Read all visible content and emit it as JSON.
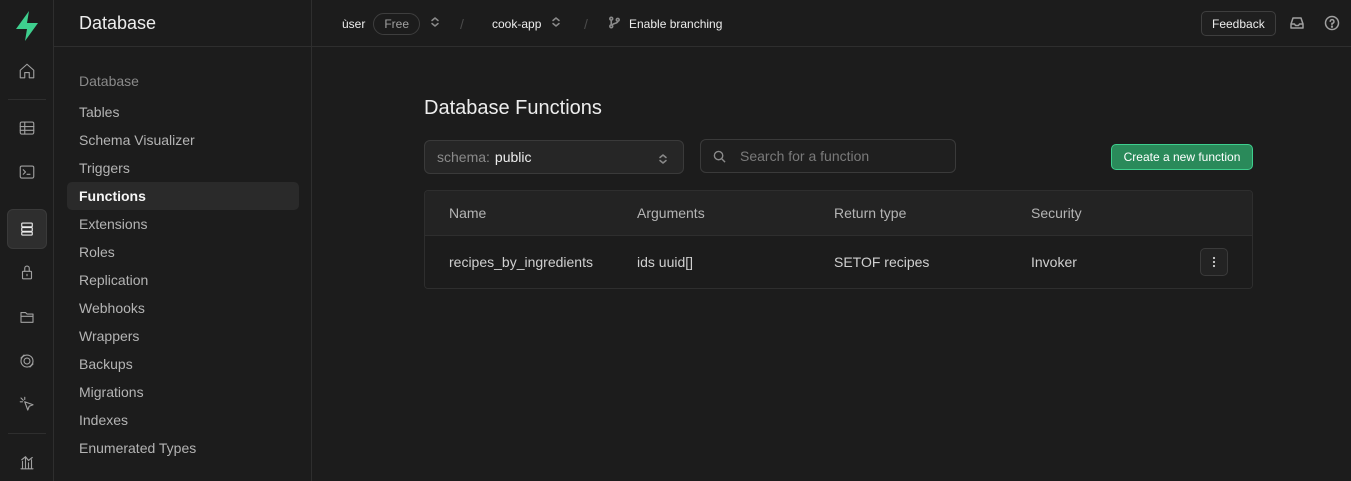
{
  "sidebar": {
    "title": "Database",
    "section_title": "Database",
    "items": [
      {
        "label": "Tables"
      },
      {
        "label": "Schema Visualizer"
      },
      {
        "label": "Triggers"
      },
      {
        "label": "Functions"
      },
      {
        "label": "Extensions"
      },
      {
        "label": "Roles"
      },
      {
        "label": "Replication"
      },
      {
        "label": "Webhooks"
      },
      {
        "label": "Wrappers"
      },
      {
        "label": "Backups"
      },
      {
        "label": "Migrations"
      },
      {
        "label": "Indexes"
      },
      {
        "label": "Enumerated Types"
      }
    ],
    "active_item": "Functions"
  },
  "rail": {
    "icons": [
      "supabase-logo",
      "home-icon",
      "table-editor-icon",
      "sql-editor-icon",
      "database-icon",
      "auth-lock-icon",
      "storage-icon",
      "realtime-icon",
      "edge-functions-icon",
      "reports-icon"
    ],
    "active_icon": "database-icon"
  },
  "topbar": {
    "org": "ùser",
    "plan_badge": "Free",
    "project": "cook-app",
    "branching_label": "Enable branching",
    "feedback_label": "Feedback"
  },
  "main": {
    "title": "Database Functions",
    "schema_label": "schema:",
    "schema_value": "public",
    "search_placeholder": "Search for a function",
    "create_label": "Create a new function",
    "columns": [
      "Name",
      "Arguments",
      "Return type",
      "Security"
    ],
    "rows": [
      {
        "name": "recipes_by_ingredients",
        "arguments": "ids uuid[]",
        "return_type": "SETOF recipes",
        "security": "Invoker"
      }
    ]
  },
  "colors": {
    "background": "#1c1c1c",
    "accent_green": "#3ecf8e",
    "button_green": "#2a8a5a"
  }
}
